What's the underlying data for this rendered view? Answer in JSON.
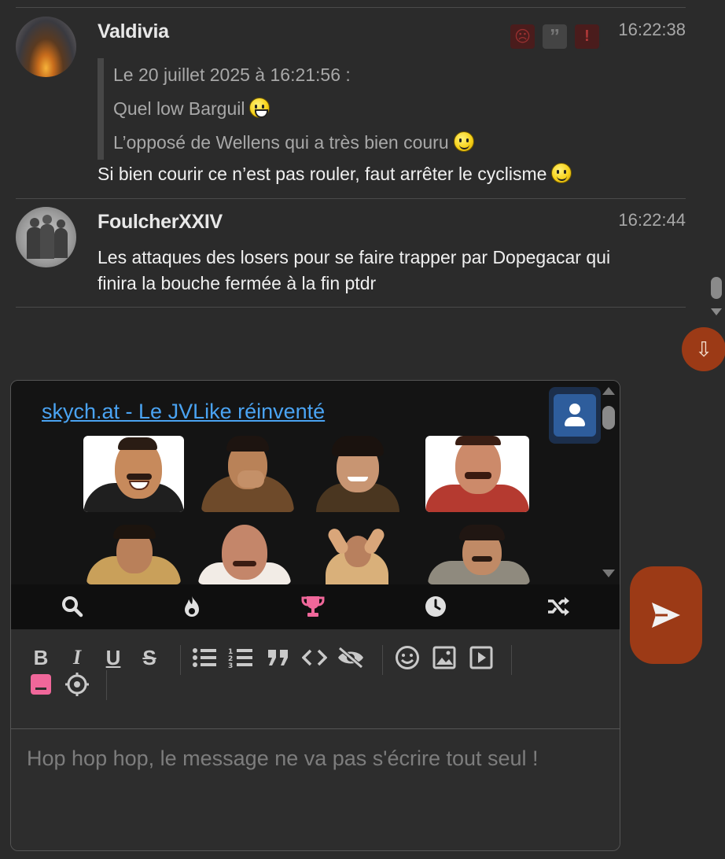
{
  "messages": [
    {
      "author": "Valdivia",
      "time": "16:22:38",
      "quote": {
        "header": "Le 20 juillet 2025 à 16:21:56 :",
        "lines": [
          "Quel low Barguil",
          "L’opposé de Wellens qui a très bien couru"
        ]
      },
      "text": "Si bien courir ce n’est pas rouler, faut arrêter le cyclisme",
      "mod_icons": [
        "sad-face-icon",
        "quote-icon",
        "alert-icon"
      ]
    },
    {
      "author": "FoulcherXXIV",
      "time": "16:22:44",
      "text_lines": [
        "Les attaques des losers pour se faire trapper par Dopegacar qui",
        "finira la bouche fermée à la fin ptdr"
      ]
    }
  ],
  "jump_down_icon": "⇩",
  "sticker_panel": {
    "link_text": "skych.at - Le JVLike réinventé",
    "tabs": [
      "search-icon",
      "fire-icon",
      "trophy-icon",
      "clock-icon",
      "shuffle-icon"
    ],
    "active_tab": "trophy-icon"
  },
  "toolbar": {
    "bold": "B",
    "italic": "I",
    "underline": "U",
    "strike": "S"
  },
  "composer": {
    "placeholder": "Hop hop hop, le message ne va pas s'écrire tout seul !"
  },
  "colors": {
    "accent": "#9c3a16",
    "link": "#4aa3f2",
    "active_tab": "#f0679a"
  }
}
